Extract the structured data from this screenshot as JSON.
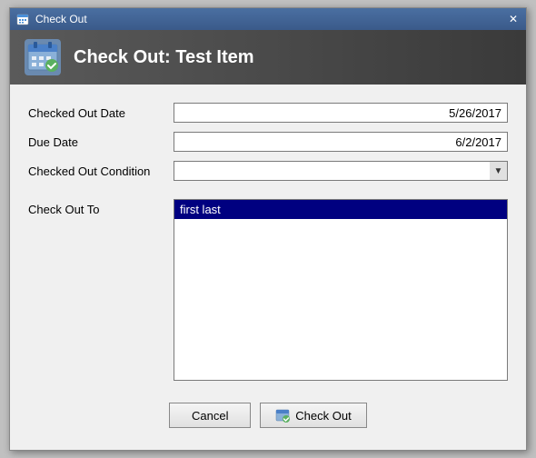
{
  "titlebar": {
    "icon": "checkout-icon",
    "text": "Check Out",
    "close_label": "✕"
  },
  "header": {
    "title": "Check Out: Test Item"
  },
  "form": {
    "checked_out_date_label": "Checked Out Date",
    "checked_out_date_value": "5/26/2017",
    "due_date_label": "Due Date",
    "due_date_value": "6/2/2017",
    "checked_out_condition_label": "Checked Out Condition",
    "checked_out_condition_value": "",
    "checkout_to_label": "Check Out To",
    "checkout_to_selected": "first last"
  },
  "buttons": {
    "cancel_label": "Cancel",
    "checkout_label": "Check Out"
  }
}
